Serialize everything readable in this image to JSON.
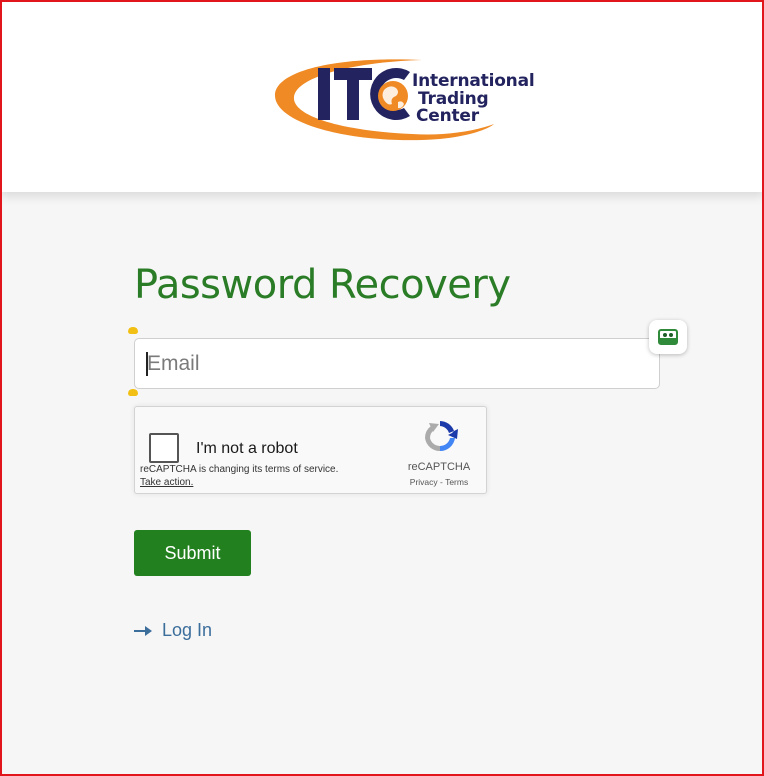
{
  "brand": {
    "logo_initials": "ITC",
    "logo_lines": [
      "International",
      "Trading",
      "Center"
    ],
    "colors": {
      "navy": "#23235f",
      "orange": "#f08a24",
      "green": "#2a7c26"
    }
  },
  "page": {
    "title": "Password Recovery"
  },
  "form": {
    "email_placeholder": "Email",
    "email_value": "",
    "submit_label": "Submit"
  },
  "captcha": {
    "checkbox_label": "I'm not a robot",
    "notice": "reCAPTCHA is changing its terms of service.",
    "action_link": "Take action.",
    "brand": "reCAPTCHA",
    "privacy": "Privacy",
    "separator": " - ",
    "terms": "Terms"
  },
  "links": {
    "login": "Log In"
  },
  "icons": {
    "password_manager": "password-manager-icon",
    "login_arrow": "arrow-right-icon",
    "recaptcha": "recaptcha-logo-icon"
  }
}
